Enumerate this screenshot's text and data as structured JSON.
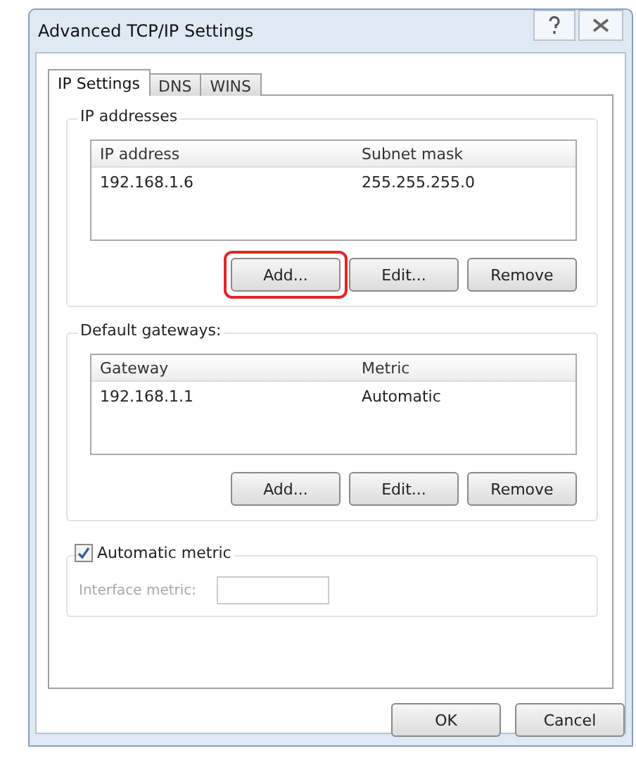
{
  "window": {
    "title": "Advanced TCP/IP Settings"
  },
  "tabs": [
    {
      "label": "IP Settings",
      "selected": true
    },
    {
      "label": "DNS",
      "selected": false
    },
    {
      "label": "WINS",
      "selected": false
    }
  ],
  "groups": [
    {
      "title": "IP addresses",
      "columns": [
        "IP address",
        "Subnet mask"
      ],
      "rows": [
        [
          "192.168.1.6",
          "255.255.255.0"
        ]
      ],
      "buttons": [
        {
          "label": "Add...",
          "highlighted": true
        },
        {
          "label": "Edit...",
          "highlighted": false
        },
        {
          "label": "Remove",
          "highlighted": false
        }
      ]
    },
    {
      "title": "Default gateways:",
      "columns": [
        "Gateway",
        "Metric"
      ],
      "rows": [
        [
          "192.168.1.1",
          "Automatic"
        ]
      ],
      "buttons": [
        {
          "label": "Add...",
          "highlighted": false
        },
        {
          "label": "Edit...",
          "highlighted": false
        },
        {
          "label": "Remove",
          "highlighted": false
        }
      ]
    }
  ],
  "metric": {
    "label": "Automatic metric",
    "checked": true,
    "field_label": "Interface metric:",
    "disabled": true
  },
  "buttons": [
    {
      "label": "OK"
    },
    {
      "label": "Cancel"
    }
  ]
}
